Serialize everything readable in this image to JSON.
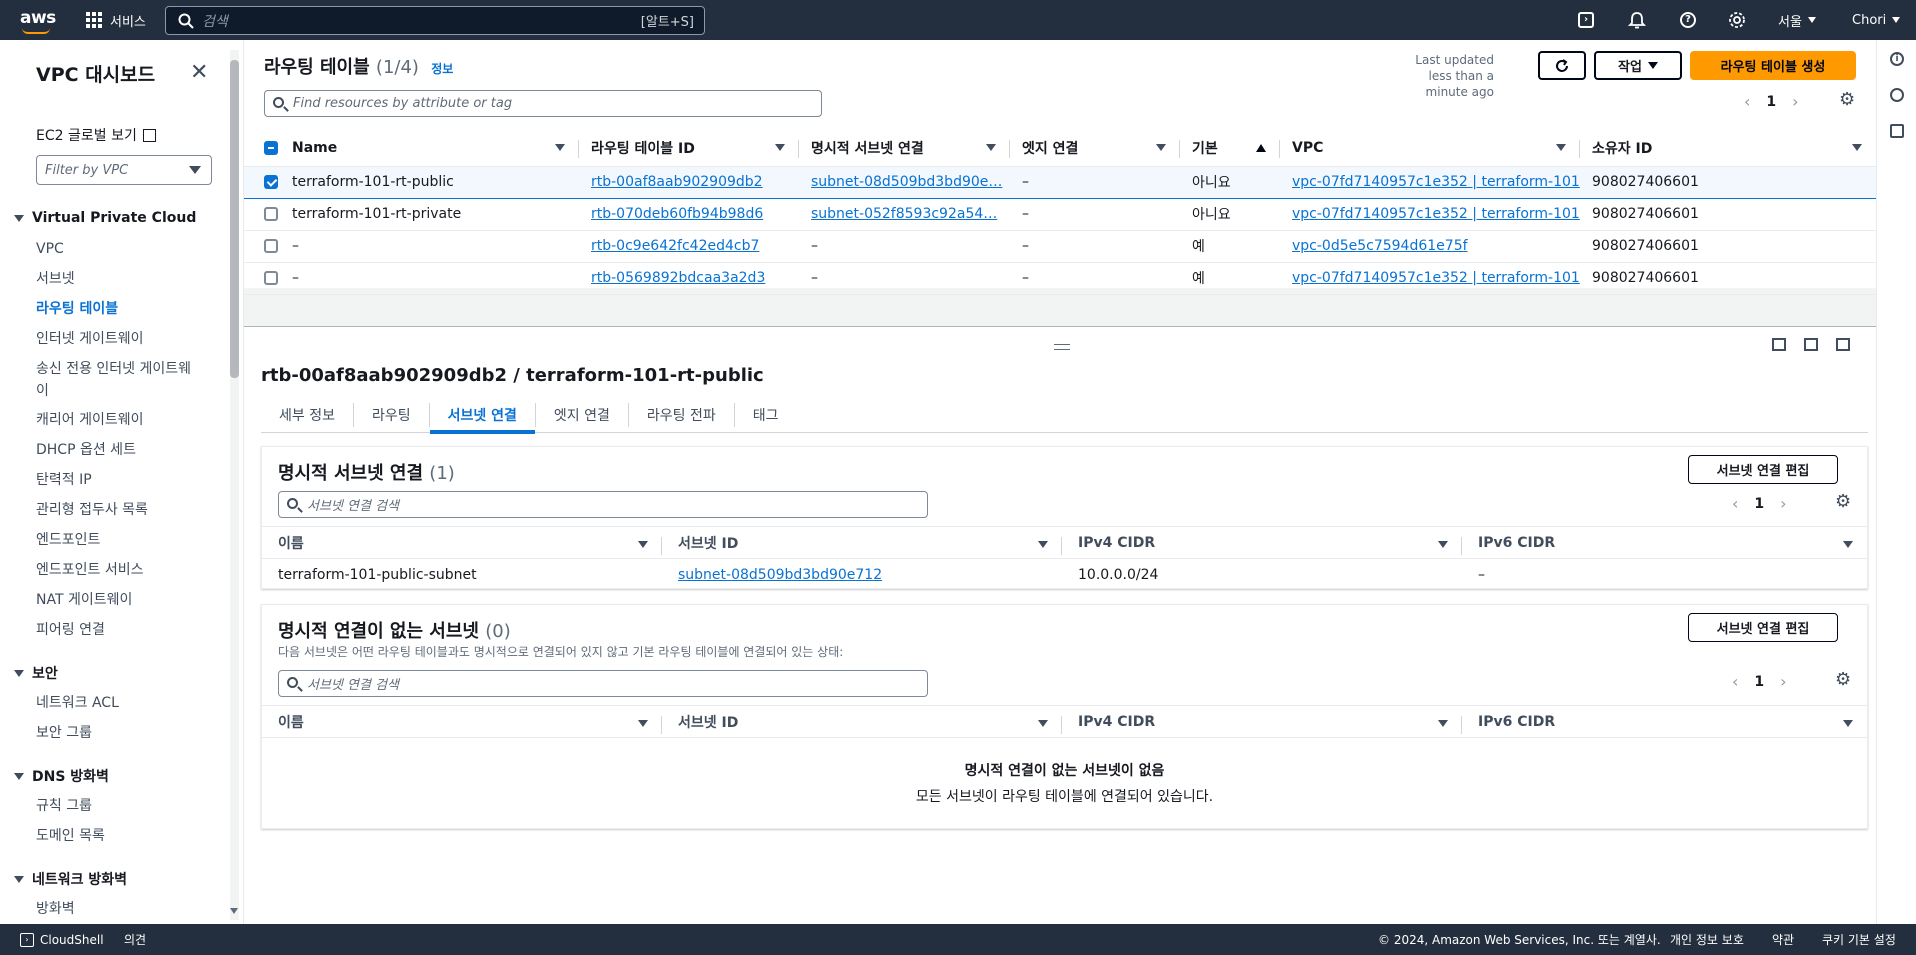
{
  "topnav": {
    "logo": "aws",
    "services_label": "서비스",
    "search_placeholder": "검색",
    "search_shortcut": "[알트+S]",
    "region": "서울",
    "user": "Chori"
  },
  "sidebar": {
    "title": "VPC 대시보드",
    "ec2_link": "EC2 글로벌 보기",
    "vpc_filter_placeholder": "Filter by VPC",
    "sections": [
      {
        "label": "Virtual Private Cloud",
        "items": [
          "VPC",
          "서브넷",
          "라우팅 테이블",
          "인터넷 게이트웨이",
          "송신 전용 인터넷 게이트웨이",
          "캐리어 게이트웨이",
          "DHCP 옵션 세트",
          "탄력적 IP",
          "관리형 접두사 목록",
          "엔드포인트",
          "엔드포인트 서비스",
          "NAT 게이트웨이",
          "피어링 연결"
        ]
      },
      {
        "label": "보안",
        "items": [
          "네트워크 ACL",
          "보안 그룹"
        ]
      },
      {
        "label": "DNS 방화벽",
        "items": [
          "규칙 그룹",
          "도메인 목록"
        ]
      },
      {
        "label": "네트워크 방화벽",
        "items": [
          "방화벽"
        ]
      }
    ],
    "active_item": "라우팅 테이블"
  },
  "route_tables": {
    "title": "라우팅 테이블",
    "count": "(1/4)",
    "info_link": "정보",
    "last_updated_line1": "Last updated",
    "last_updated_line2": "less than a minute ago",
    "actions_label": "작업",
    "create_label": "라우팅 테이블 생성",
    "search_placeholder": "Find resources by attribute or tag",
    "page": "1",
    "columns": [
      "Name",
      "라우팅 테이블 ID",
      "명시적 서브넷 연결",
      "엣지 연결",
      "기본",
      "VPC",
      "소유자 ID"
    ],
    "rows": [
      {
        "name": "terraform-101-rt-public",
        "id": "rtb-00af8aab902909db2",
        "subnet": "subnet-08d509bd3bd90e…",
        "edge": "–",
        "main": "아니요",
        "vpc": "vpc-07fd7140957c1e352 | terraform-101",
        "owner": "908027406601",
        "selected": true
      },
      {
        "name": "terraform-101-rt-private",
        "id": "rtb-070deb60fb94b98d6",
        "subnet": "subnet-052f8593c92a54…",
        "edge": "–",
        "main": "아니요",
        "vpc": "vpc-07fd7140957c1e352 | terraform-101",
        "owner": "908027406601",
        "selected": false
      },
      {
        "name": "–",
        "id": "rtb-0c9e642fc42ed4cb7",
        "subnet": "–",
        "edge": "–",
        "main": "예",
        "vpc": "vpc-0d5e5c7594d61e75f",
        "owner": "908027406601",
        "selected": false
      },
      {
        "name": "–",
        "id": "rtb-0569892bdcaa3a2d3",
        "subnet": "–",
        "edge": "–",
        "main": "예",
        "vpc": "vpc-07fd7140957c1e352 | terraform-101",
        "owner": "908027406601",
        "selected": false
      }
    ]
  },
  "detail": {
    "title": "rtb-00af8aab902909db2 / terraform-101-rt-public",
    "tabs": [
      "세부 정보",
      "라우팅",
      "서브넷 연결",
      "엣지 연결",
      "라우팅 전파",
      "태그"
    ],
    "active_tab": "서브넷 연결",
    "explicit": {
      "title": "명시적 서브넷 연결",
      "count": "(1)",
      "edit_label": "서브넷 연결 편집",
      "search_placeholder": "서브넷 연결 검색",
      "page": "1",
      "columns": [
        "이름",
        "서브넷 ID",
        "IPv4 CIDR",
        "IPv6 CIDR"
      ],
      "rows": [
        {
          "name": "terraform-101-public-subnet",
          "subnet_id": "subnet-08d509bd3bd90e712",
          "ipv4": "10.0.0.0/24",
          "ipv6": "–"
        }
      ]
    },
    "without": {
      "title": "명시적 연결이 없는 서브넷",
      "count": "(0)",
      "description": "다음 서브넷은 어떤 라우팅 테이블과도 명시적으로 연결되어 있지 않고 기본 라우팅 테이블에 연결되어 있는 상태:",
      "edit_label": "서브넷 연결 편집",
      "search_placeholder": "서브넷 연결 검색",
      "page": "1",
      "columns": [
        "이름",
        "서브넷 ID",
        "IPv4 CIDR",
        "IPv6 CIDR"
      ],
      "empty_title": "명시적 연결이 없는 서브넷이 없음",
      "empty_subtitle": "모든 서브넷이 라우팅 테이블에 연결되어 있습니다."
    }
  },
  "footer": {
    "cloudshell": "CloudShell",
    "feedback": "의견",
    "copyright": "© 2024, Amazon Web Services, Inc. 또는 계열사.",
    "privacy": "개인 정보 보호",
    "terms": "약관",
    "cookies": "쿠키 기본 설정"
  },
  "colors": {
    "nav_bg": "#232f3e",
    "accent": "#0972d3",
    "primary_button": "#ff9900"
  }
}
